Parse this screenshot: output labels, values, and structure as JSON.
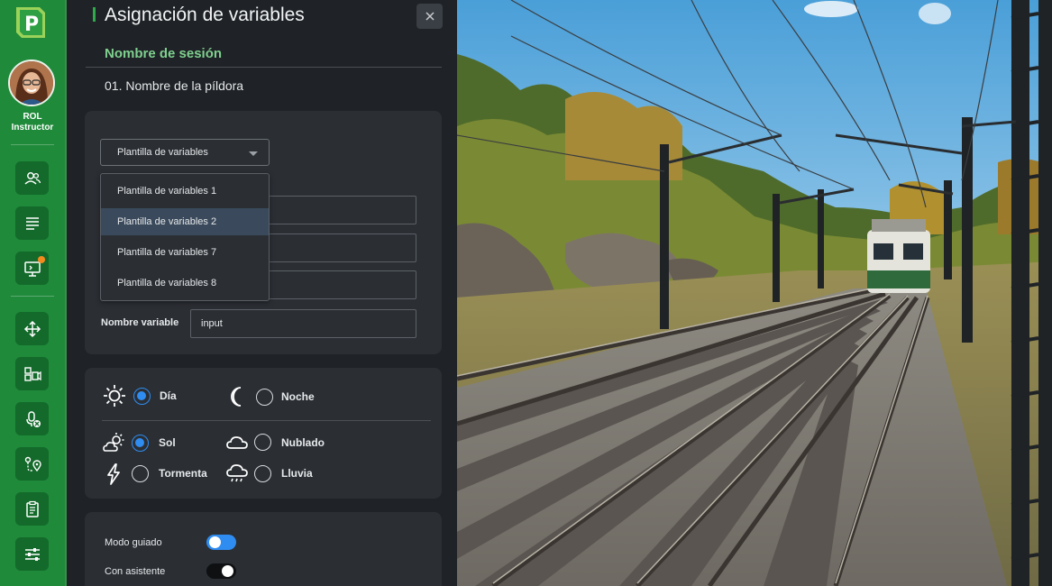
{
  "sidebar": {
    "logo_icon": "p-logo",
    "role_line1": "ROL",
    "role_line2": "Instructor",
    "items": [
      {
        "name": "users-icon"
      },
      {
        "name": "list-icon"
      },
      {
        "name": "monitor-icon",
        "notification": true
      },
      {
        "name": "move-icon"
      },
      {
        "name": "camera-views-icon"
      },
      {
        "name": "mic-off-icon"
      },
      {
        "name": "route-icon"
      },
      {
        "name": "checklist-icon"
      },
      {
        "name": "sliders-icon"
      }
    ]
  },
  "panel": {
    "title": "Asignación de variables",
    "close_label": "×",
    "session_label": "Nombre de sesión",
    "pill_name": "01. Nombre de la píldora"
  },
  "variables": {
    "select_label": "Plantilla de variables",
    "dropdown_options": [
      "Plantilla de variables 1",
      "Plantilla de variables 2",
      "Plantilla de variables 7",
      "Plantilla de variables 8"
    ],
    "selected_option": "Plantilla de variables 2",
    "variable_label": "Nombre variable",
    "variable_value": "input"
  },
  "conditions": {
    "time": [
      {
        "label": "Día",
        "icon": "sun-icon",
        "selected": true
      },
      {
        "label": "Noche",
        "icon": "moon-icon",
        "selected": false
      }
    ],
    "weather": [
      {
        "label": "Sol",
        "icon": "sun-cloud-icon",
        "selected": true
      },
      {
        "label": "Nublado",
        "icon": "cloud-icon",
        "selected": false
      },
      {
        "label": "Tormenta",
        "icon": "lightning-icon",
        "selected": false
      },
      {
        "label": "Lluvia",
        "icon": "rain-icon",
        "selected": false
      }
    ]
  },
  "options": {
    "guided_label": "Modo guiado",
    "guided_on": true,
    "assistant_label": "Con asistente",
    "assistant_on": false
  },
  "colors": {
    "brand_green": "#1f8a3a",
    "accent_blue": "#2f8cf0",
    "session_green": "#7fd08f",
    "notification_orange": "#f28a1e"
  }
}
